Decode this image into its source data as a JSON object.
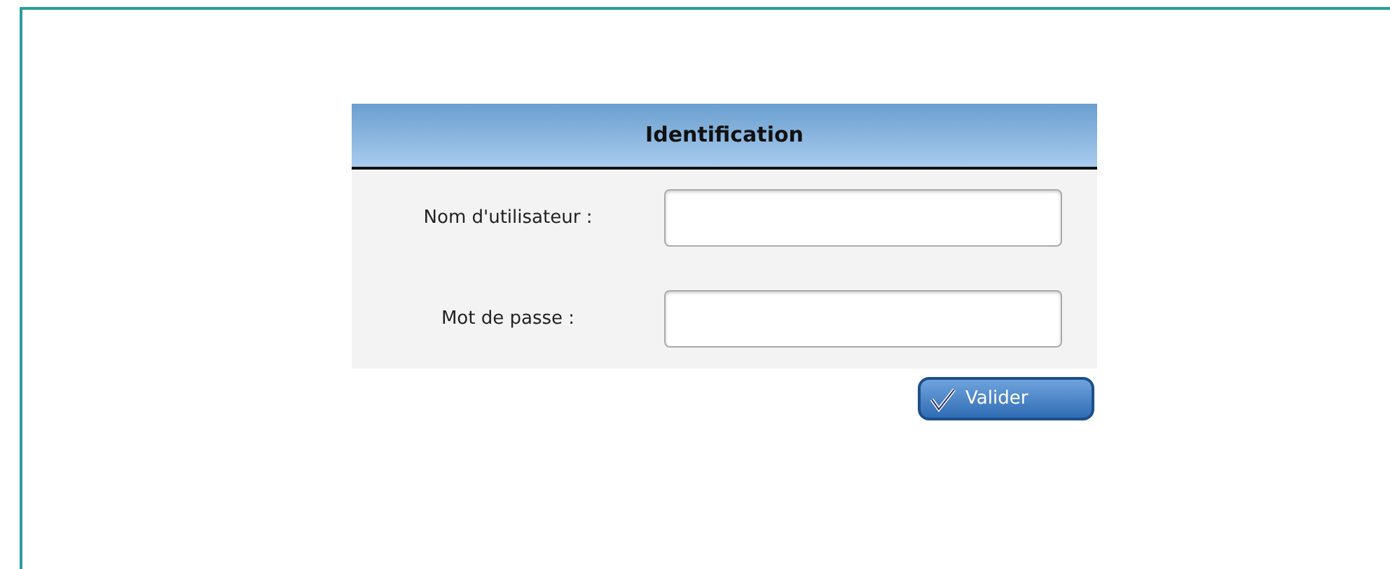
{
  "login_panel": {
    "title": "Identification",
    "fields": [
      {
        "label": "Nom d'utilisateur :"
      },
      {
        "label": "Mot de passe :"
      }
    ],
    "submit_button": "Valider"
  }
}
